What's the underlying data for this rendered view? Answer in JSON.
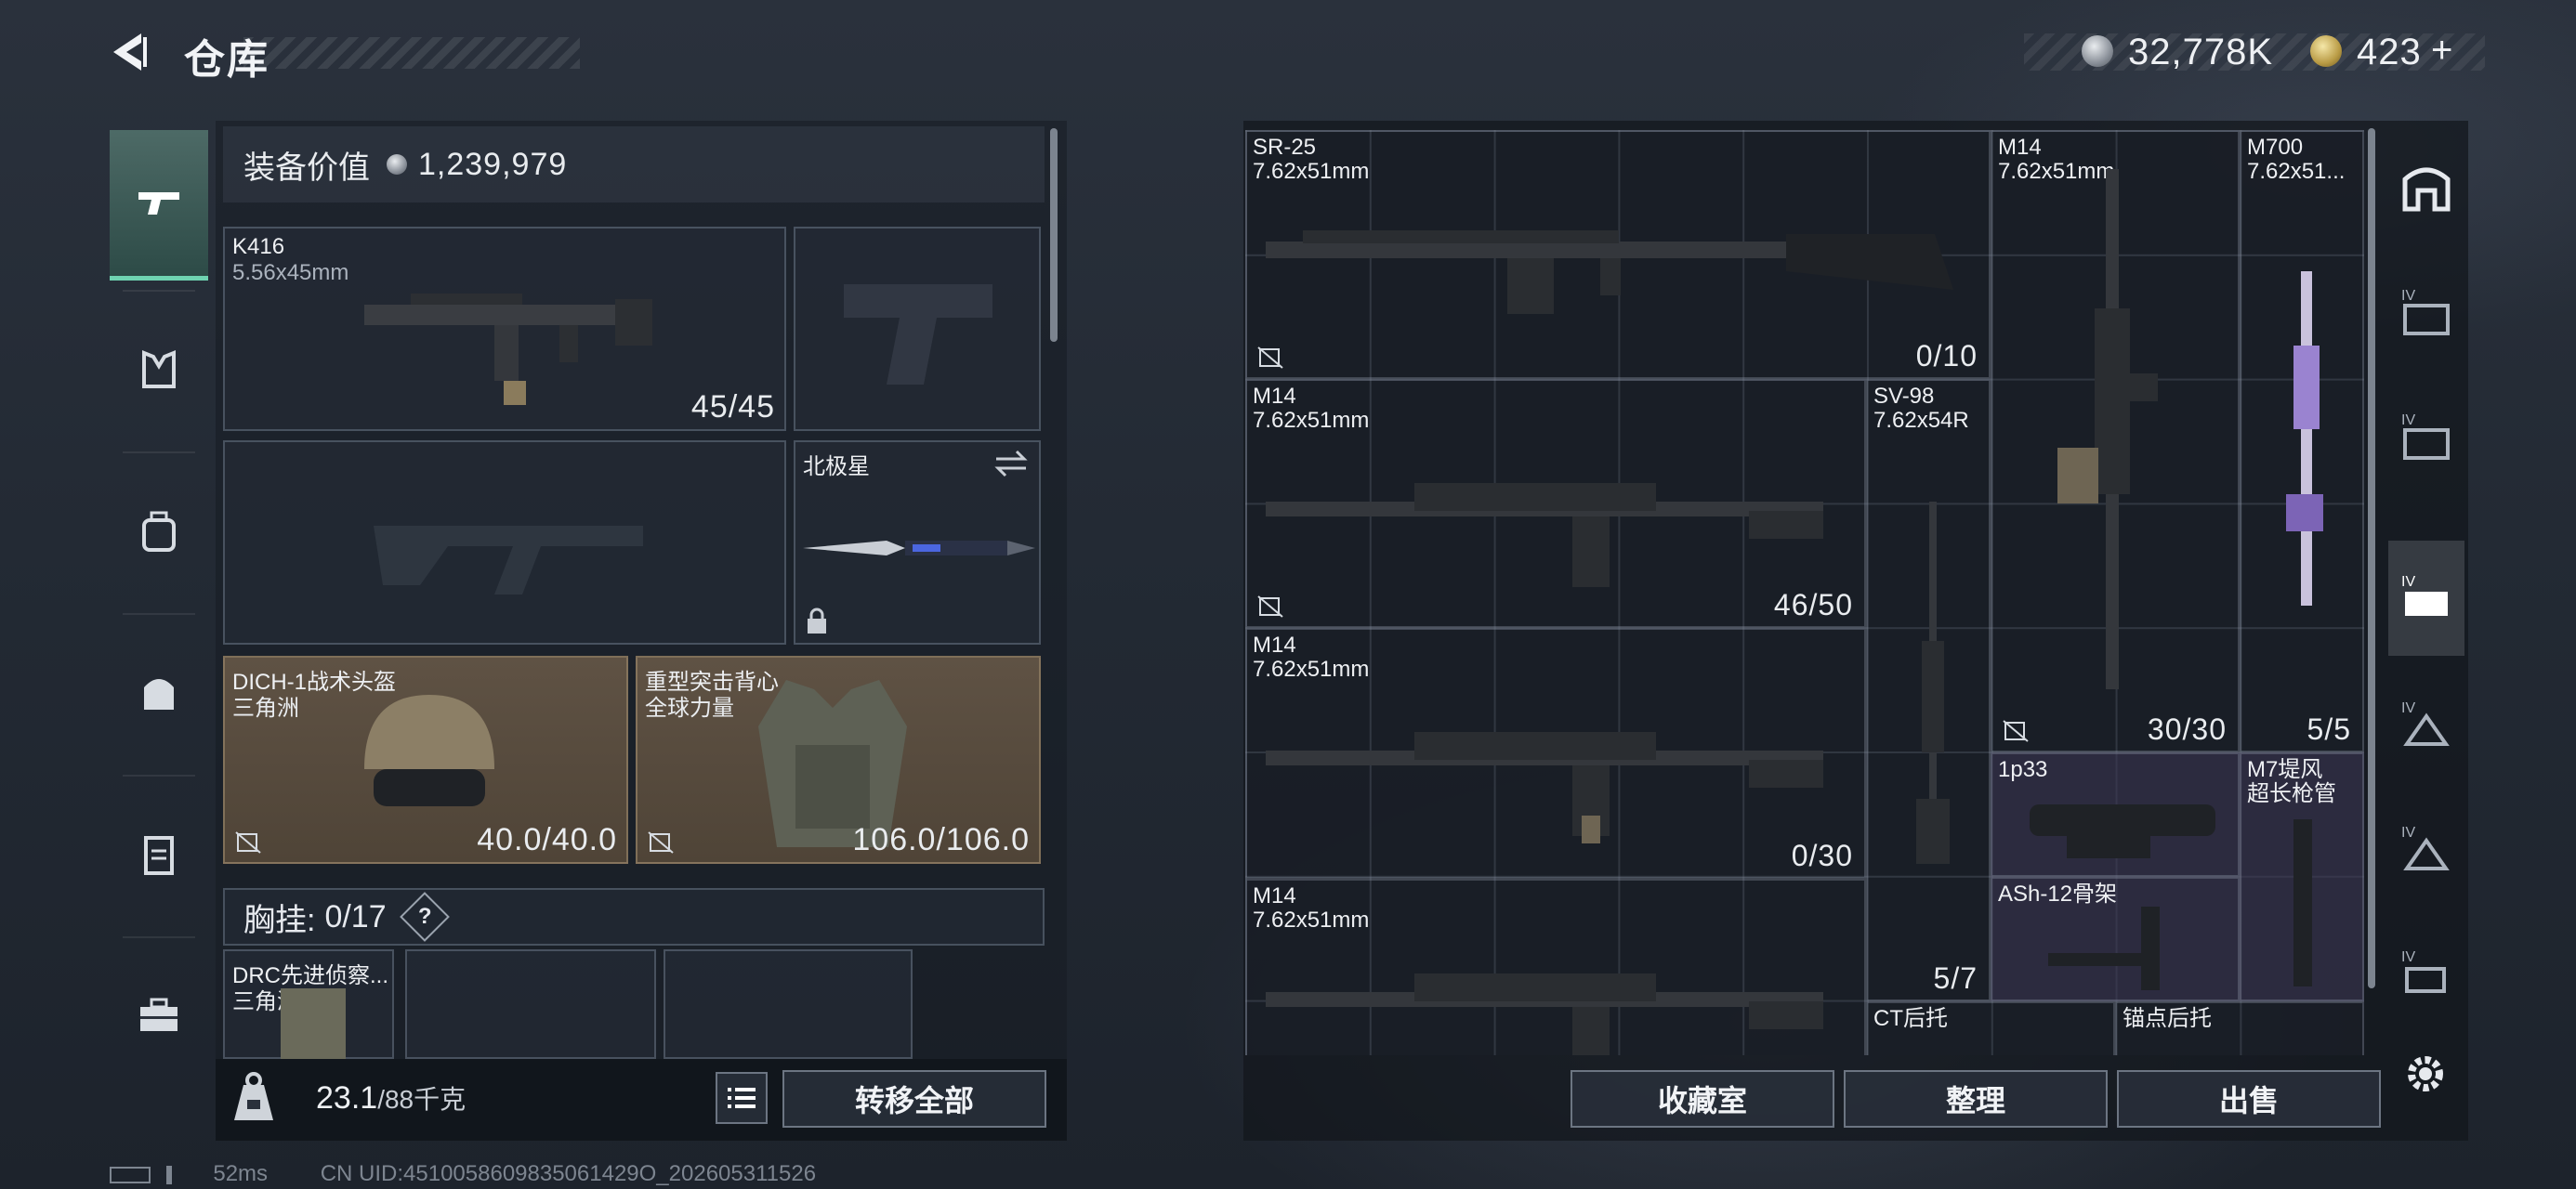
{
  "header": {
    "title": "仓库"
  },
  "currency": {
    "silver": "32,778K",
    "gold": "423",
    "add": "+"
  },
  "leftnav": {
    "items": [
      {
        "icon": "pistol-icon"
      },
      {
        "icon": "armor-icon"
      },
      {
        "icon": "backpack-icon"
      },
      {
        "icon": "bag-icon"
      },
      {
        "icon": "clipboard-icon"
      },
      {
        "icon": "toolbox-icon"
      }
    ]
  },
  "equipment": {
    "value_label": "装备价值",
    "value": "1,239,979",
    "primary": {
      "name": "K416",
      "caliber": "5.56x45mm",
      "count": "45/45"
    },
    "melee": {
      "name": "北极星"
    },
    "helmet": {
      "name": "DICH-1战术头盔",
      "brand": "三角洲",
      "durability": "40.0/40.0"
    },
    "armor": {
      "name": "重型突击背心",
      "brand": "全球力量",
      "durability": "106.0/106.0"
    },
    "chest_rig": {
      "label": "胸挂:",
      "count": "0/17",
      "help": "?"
    },
    "rig_item": {
      "name": "DRC先进侦察...",
      "brand": "三角洲"
    }
  },
  "footer_left": {
    "weight": "23.1",
    "weight_max": "/88千克",
    "transfer_all": "转移全部"
  },
  "storage": {
    "items": [
      {
        "name": "SR-25",
        "caliber": "7.62x51mm",
        "count": "0/10"
      },
      {
        "name": "M14",
        "caliber": "7.62x51mm",
        "count": "30/30"
      },
      {
        "name": "M700",
        "caliber": "7.62x51...",
        "count": "5/5"
      },
      {
        "name": "M14",
        "caliber": "7.62x51mm",
        "count": "46/50"
      },
      {
        "name": "SV-98",
        "caliber": "7.62x54R",
        "count": "5/7"
      },
      {
        "name": "M14",
        "caliber": "7.62x51mm",
        "count": "0/30"
      },
      {
        "name": "1p33",
        "caliber": "",
        "count": ""
      },
      {
        "name": "M7堤风",
        "caliber": "超长枪管",
        "count": ""
      },
      {
        "name": "ASh-12骨架",
        "caliber": "",
        "count": ""
      },
      {
        "name": "M14",
        "caliber": "7.62x51mm",
        "count": ""
      },
      {
        "name": "CT后托",
        "caliber": "",
        "count": ""
      },
      {
        "name": "锚点后托",
        "caliber": "",
        "count": ""
      }
    ]
  },
  "footer_right": {
    "collection": "收藏室",
    "organize": "整理",
    "sell": "出售"
  },
  "rightnav": {
    "items": [
      "storage-arch-icon",
      "tier-iv-storage-icon",
      "tier-iv-storage-icon",
      "tier-iv-case-icon",
      "tier-iv-case-icon",
      "tier-iv-case-icon",
      "tier-iv-case-icon"
    ]
  },
  "status": {
    "ping": "52ms",
    "uid": "CN UID:4510058609835061429O_202605311526"
  },
  "colors": {
    "accent": "#6fd3b1",
    "brown_slot": "#5f5244",
    "purple_slot": "#3c3654",
    "panel": "#1a1f27"
  }
}
